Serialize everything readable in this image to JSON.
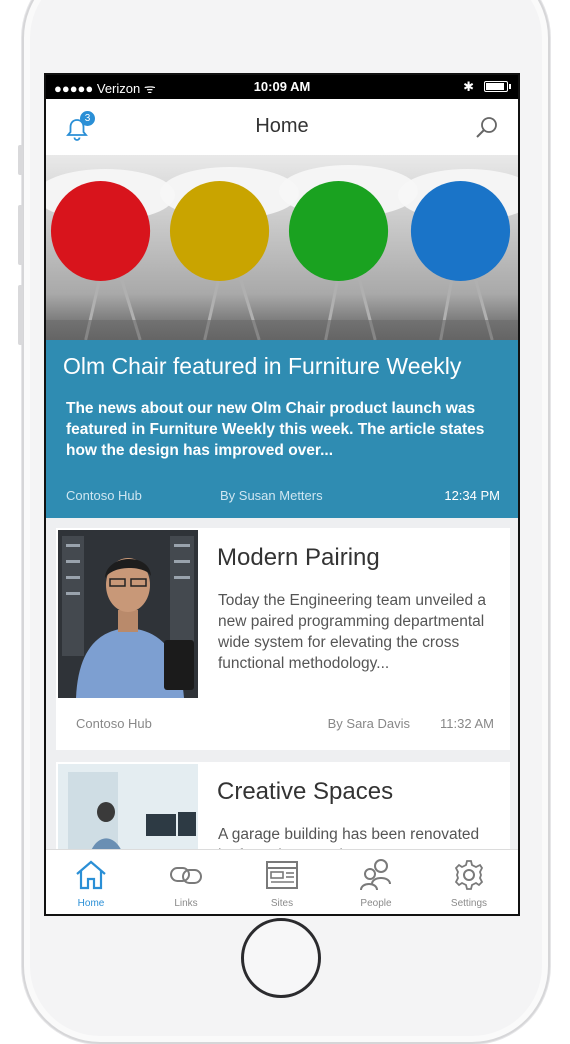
{
  "status_bar": {
    "carrier": "●●●●● Verizon ᯤ",
    "time": "10:09 AM",
    "bluetooth": "✱"
  },
  "nav": {
    "title": "Home",
    "badge_count": "3",
    "left_icon": "bell-icon",
    "right_icon": "search-icon"
  },
  "hero": {
    "title": "Olm Chair featured in Furniture Weekly",
    "text": "The news about our new Olm Chair product launch was featured in Furniture Weekly this week. The article states how the design has improved over...",
    "source": "Contoso Hub",
    "author": "By Susan Metters",
    "time": "12:34 PM",
    "accent": "#2f8cb2"
  },
  "cards": [
    {
      "title": "Modern Pairing",
      "text": "Today the Engineering team unveiled a new paired programming departmental wide system for elevating the cross functional methodology...",
      "source": "Contoso Hub",
      "author": "By Sara Davis",
      "time": "11:32 AM"
    },
    {
      "title": "Creative Spaces",
      "text": "A garage building has been renovated by famed Amsterdam"
    }
  ],
  "tabs": [
    {
      "label": "Home",
      "icon": "home-icon",
      "active": true
    },
    {
      "label": "Links",
      "icon": "link-icon"
    },
    {
      "label": "Sites",
      "icon": "sites-icon"
    },
    {
      "label": "People",
      "icon": "people-icon"
    },
    {
      "label": "Settings",
      "icon": "gear-icon"
    }
  ],
  "colors": {
    "tab_active": "#2a8fd6",
    "tab_inactive": "#8a8a8a"
  }
}
